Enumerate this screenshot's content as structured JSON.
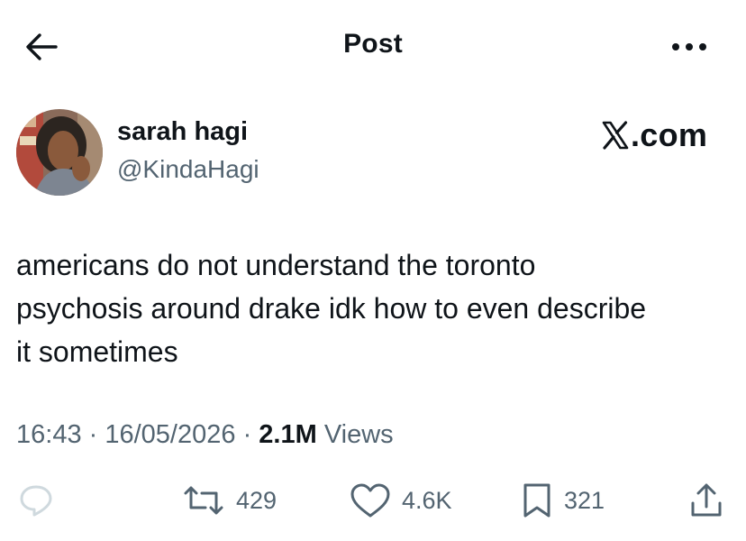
{
  "header": {
    "title": "Post"
  },
  "author": {
    "name": "sarah hagi",
    "handle": "@KindaHagi"
  },
  "watermark": {
    "text": ".com"
  },
  "tweet": {
    "text": "americans do not understand the toronto\npsychosis around drake idk how to even describe\nit sometimes"
  },
  "meta": {
    "time": "16:43",
    "sep1": " · ",
    "date": "16/05/2026",
    "sep2": " · ",
    "views_count": "2.1M",
    "views_label": " Views"
  },
  "actions": {
    "retweets": "429",
    "likes": "4.6K",
    "bookmarks": "321"
  },
  "colors": {
    "text": "#0f1419",
    "secondary": "#536471",
    "reply_icon": "#cfd9de"
  }
}
